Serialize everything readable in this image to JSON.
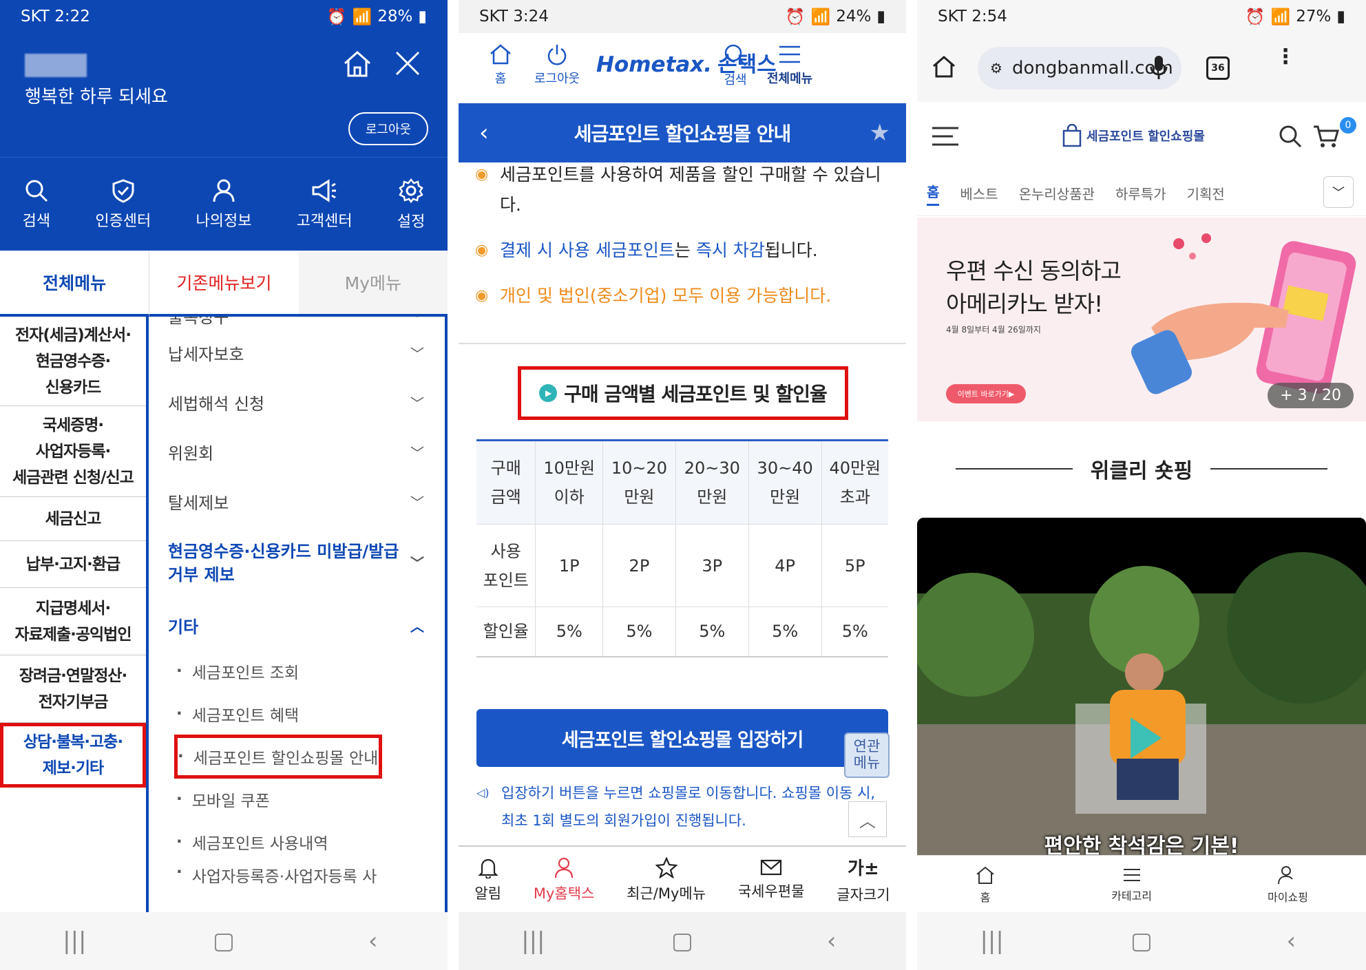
{
  "panel1": {
    "status": {
      "carrier_time": "SKT 2:22",
      "battery": "28%"
    },
    "greeting": "행복한 하루 되세요",
    "logout_label": "로그아웃",
    "icons": [
      {
        "label": "검색"
      },
      {
        "label": "인증센터"
      },
      {
        "label": "나의정보"
      },
      {
        "label": "고객센터"
      },
      {
        "label": "설정"
      }
    ],
    "tabs": [
      "전체메뉴",
      "기존메뉴보기",
      "My메뉴"
    ],
    "left_categories": [
      {
        "label": "전자(세금)계산서·\n현금영수증·\n신용카드"
      },
      {
        "label": "국세증명·\n사업자등록·\n세금관련 신청/신고"
      },
      {
        "label": "세금신고"
      },
      {
        "label": "납부·고지·환급"
      },
      {
        "label": "지급명세서·\n자료제출·공익법인"
      },
      {
        "label": "장려금·연말정산·\n전자기부금"
      },
      {
        "label": "상담·불복·고충·\n제보·기타"
      }
    ],
    "right_items": [
      {
        "label": "불복청구"
      },
      {
        "label": "납세자보호"
      },
      {
        "label": "세법해석 신청"
      },
      {
        "label": "위원회"
      },
      {
        "label": "탈세제보"
      },
      {
        "label": "현금영수증·신용카드 미발급/발급거부 제보"
      },
      {
        "label": "기타"
      }
    ],
    "sub_items": [
      {
        "label": "세금포인트 조회"
      },
      {
        "label": "세금포인트 혜택"
      },
      {
        "label": "세금포인트 할인쇼핑몰 안내"
      },
      {
        "label": "모바일 쿠폰"
      },
      {
        "label": "세금포인트 사용내역"
      },
      {
        "label": "사업자등록증·사업자등록 사"
      }
    ]
  },
  "panel2": {
    "status": {
      "carrier_time": "SKT 3:24",
      "battery": "24%"
    },
    "header": {
      "home": "홈",
      "logout": "로그아웃",
      "logo_en": "Hometax.",
      "logo_kr": "손택스",
      "search": "검색",
      "menu": "전체메뉴"
    },
    "title": "세금포인트 할인쇼핑몰 안내",
    "bullet1": "세금포인트를 사용하여 제품을 할인 구매할 수 있습니다.",
    "bullet2_a": "결제 시 사용 세금포인트",
    "bullet2_b": "는",
    "bullet2_c": "즉시 차감",
    "bullet2_d": "됩니다.",
    "bullet3": "개인 및 법인(중소기업) 모두 이용 가능합니다.",
    "section_title": "구매 금액별 세금포인트 및 할인율",
    "table": {
      "headers": [
        "구매\n금액",
        "10만원\n이하",
        "10~20\n만원",
        "20~30\n만원",
        "30~40\n만원",
        "40만원\n초과"
      ],
      "rows": [
        [
          "사용\n포인트",
          "1P",
          "2P",
          "3P",
          "4P",
          "5P"
        ],
        [
          "할인율",
          "5%",
          "5%",
          "5%",
          "5%",
          "5%"
        ]
      ]
    },
    "enter_button": "세금포인트 할인쇼핑몰 입장하기",
    "related_menu": "연관\n메뉴",
    "note": "입장하기 버튼을 누르면 쇼핑몰로 이동합니다. 쇼핑몰 이동 시, 최초 1회 별도의 회원가입이 진행됩니다.",
    "bottom": [
      "알림",
      "My홈택스",
      "최근/My메뉴",
      "국세우편물",
      "글자크기"
    ],
    "font_size_glyph": "가±"
  },
  "panel3": {
    "status": {
      "carrier_time": "SKT 2:54",
      "battery": "27%"
    },
    "url": "dongbanmall.com",
    "tab_count": "36",
    "shop_logo": "세금포인트 할인쇼핑몰",
    "cart_count": "0",
    "menu": [
      "홈",
      "베스트",
      "온누리상품관",
      "하루특가",
      "기획전"
    ],
    "banner": {
      "title": "우편 수신 동의하고\n아메리카노 받자!",
      "date": "4월 8일부터 4월 26일까지",
      "button": "이벤트 바로가기▶",
      "counter": "+ 3 / 20"
    },
    "weekly_title": "위클리 숏핑",
    "video_caption": "편안한 착석감은 기본!",
    "bottom": [
      "홈",
      "카테고리",
      "마이쇼핑"
    ]
  },
  "colors": {
    "hometax_blue": "#0d47b4",
    "highlight_red": "#e01010",
    "accent_orange": "#f39a2a"
  }
}
